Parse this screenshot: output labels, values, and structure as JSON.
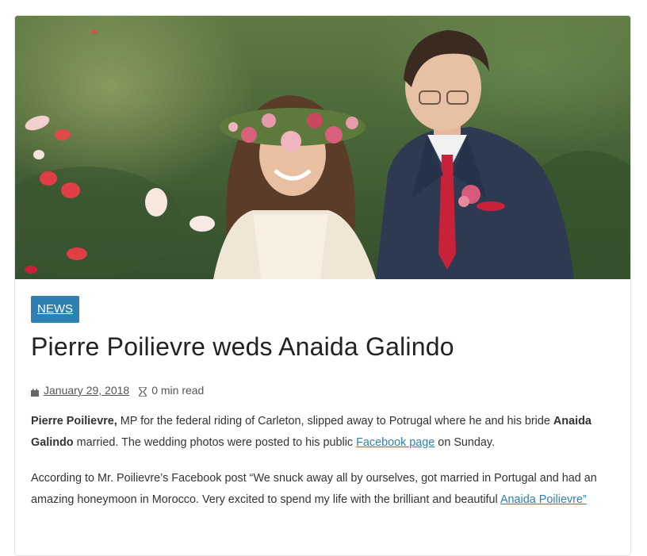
{
  "article": {
    "category": "NEWS",
    "title": "Pierre Poilievre weds Anaida Galindo",
    "date": "January 29, 2018",
    "read_time": "0 min read",
    "para1": {
      "bold1": "Pierre Poilievre,",
      "text1": " MP for the federal riding of Carleton, slipped away to Potrugal where he and his bride ",
      "bold2": "Anaida Galindo",
      "text2": " married.   The wedding photos were posted to his public ",
      "link": "Facebook page",
      "text3": " on Sunday."
    },
    "para2": {
      "text1": "According to  Mr. Poilievre’s Facebook post “We snuck away all by ourselves, got married in Portugal and had an amazing honeymoon in Morocco. Very excited to spend my life with the brilliant and beautiful ",
      "link": "Anaida Poilievre”"
    }
  },
  "icons": {
    "date": "calendar-icon",
    "read_time": "hourglass-icon"
  },
  "colors": {
    "badge": "#2e7fb2",
    "link": "#2e7fb2"
  }
}
